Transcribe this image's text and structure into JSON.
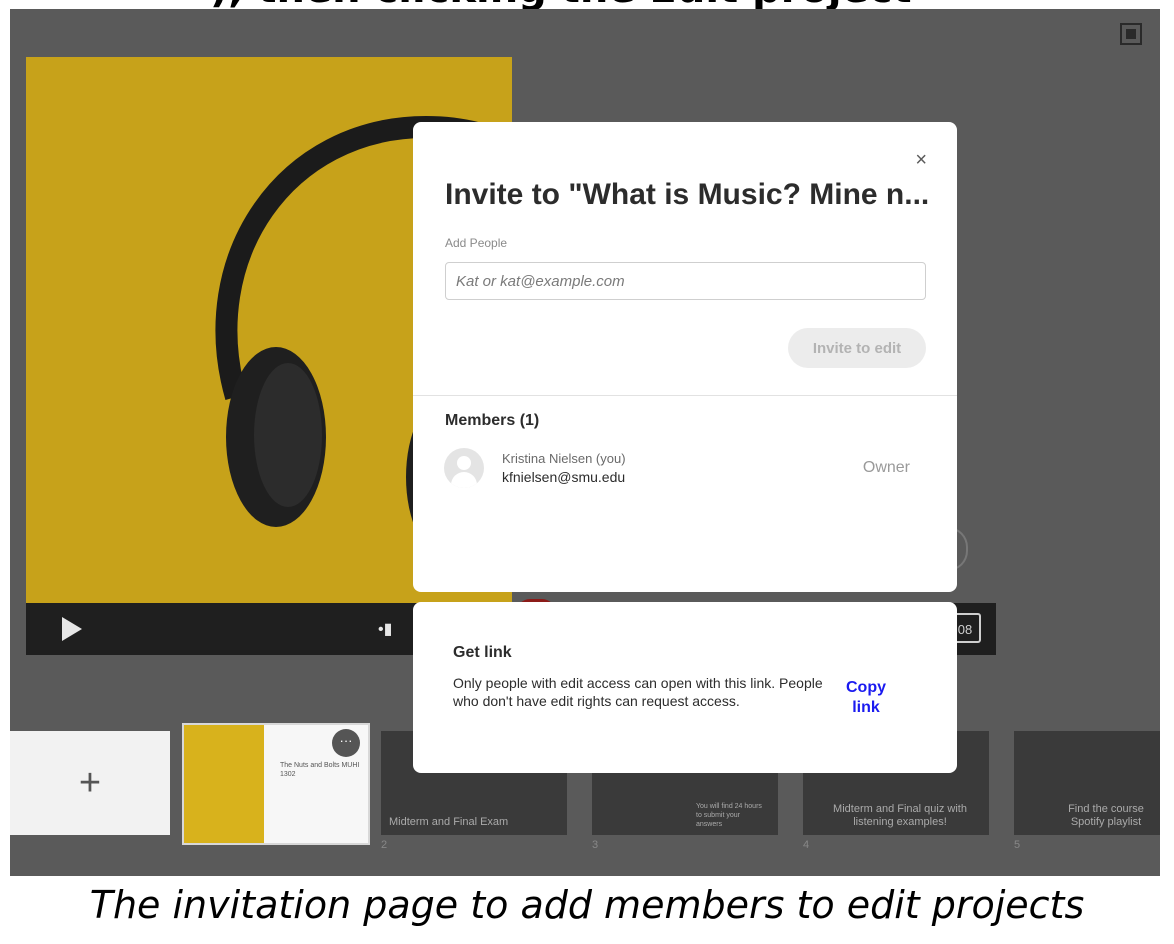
{
  "dialog": {
    "title": "Invite to \"What is Music? Mine n...",
    "close_label": "×",
    "add_people_label": "Add People",
    "add_people_placeholder": "Kat or kat@example.com",
    "invite_button": "Invite to edit",
    "members_title": "Members (1)",
    "members": [
      {
        "name": "Kristina Nielsen (you)",
        "email": "kfnielsen@smu.edu",
        "role": "Owner"
      }
    ]
  },
  "get_link": {
    "title": "Get link",
    "description": "Only people with edit access can open with this link. People who don't have edit rights can request access.",
    "copy_button": "Copy link"
  },
  "player": {
    "time_text": "08"
  },
  "slides": {
    "add_label": "+",
    "thumb1_text": "The Nuts and Bolts MUHI 1302",
    "more_label": "···",
    "items": [
      {
        "number": "2",
        "caption": "Midterm and Final Exam"
      },
      {
        "number": "3",
        "caption": "You will find 24 hours to submit your answers"
      },
      {
        "number": "4",
        "caption": "Midterm and Final quiz with listening examples!"
      },
      {
        "number": "5",
        "caption": "Find the course Spotify playlist"
      }
    ]
  },
  "caption": "The invitation page to add members to edit projects"
}
